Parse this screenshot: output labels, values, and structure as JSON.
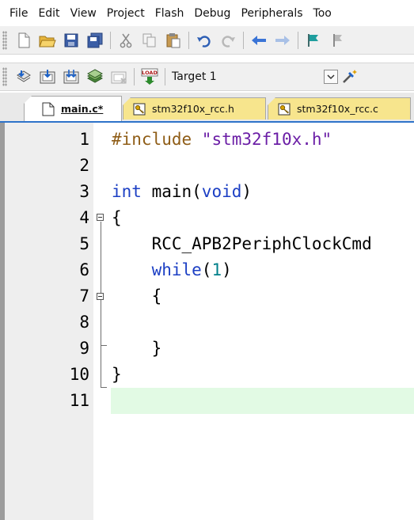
{
  "menu": [
    "File",
    "Edit",
    "View",
    "Project",
    "Flash",
    "Debug",
    "Peripherals",
    "Too"
  ],
  "toolbar1": {
    "icons": [
      "new-file-icon",
      "open-folder-icon",
      "save-icon",
      "save-all-icon",
      "cut-icon",
      "copy-icon",
      "paste-icon",
      "undo-icon",
      "redo-icon",
      "navigate-back-icon",
      "navigate-forward-icon",
      "bookmark-icon",
      "bookmark-prev-icon"
    ]
  },
  "toolbar2": {
    "icons": [
      "translate-icon",
      "build-icon",
      "rebuild-icon",
      "batch-build-icon",
      "stop-build-icon",
      "download-icon",
      "target-options-icon"
    ],
    "download_label": "LOAD",
    "target": "Target 1"
  },
  "tabs": [
    {
      "label": "main.c*",
      "active": true
    },
    {
      "label": "stm32f10x_rcc.h",
      "active": false
    },
    {
      "label": "stm32f10x_rcc.c",
      "active": false
    }
  ],
  "editor": {
    "lines": [
      {
        "n": "1",
        "tokens": [
          {
            "t": "#include ",
            "c": "pp"
          },
          {
            "t": "\"stm32f10x.h\"",
            "c": "str"
          }
        ]
      },
      {
        "n": "2",
        "tokens": []
      },
      {
        "n": "3",
        "tokens": [
          {
            "t": "int",
            "c": "kw"
          },
          {
            "t": " main(",
            "c": ""
          },
          {
            "t": "void",
            "c": "kw"
          },
          {
            "t": ")",
            "c": ""
          }
        ]
      },
      {
        "n": "4",
        "tokens": [
          {
            "t": "{",
            "c": ""
          }
        ]
      },
      {
        "n": "5",
        "tokens": [
          {
            "t": "    RCC_APB2PeriphClockCmd",
            "c": ""
          }
        ]
      },
      {
        "n": "6",
        "tokens": [
          {
            "t": "    ",
            "c": ""
          },
          {
            "t": "while",
            "c": "kw"
          },
          {
            "t": "(",
            "c": ""
          },
          {
            "t": "1",
            "c": "num"
          },
          {
            "t": ")",
            "c": ""
          }
        ]
      },
      {
        "n": "7",
        "tokens": [
          {
            "t": "    {",
            "c": ""
          }
        ]
      },
      {
        "n": "8",
        "tokens": []
      },
      {
        "n": "9",
        "tokens": [
          {
            "t": "    }",
            "c": ""
          }
        ]
      },
      {
        "n": "10",
        "tokens": [
          {
            "t": "}",
            "c": ""
          }
        ]
      },
      {
        "n": "11",
        "tokens": []
      }
    ],
    "current_line": "11"
  },
  "colors": {
    "keyword": "#1c3fc4",
    "preprocessor": "#8f5d17",
    "string": "#6b1ea6",
    "number": "#00808a",
    "current_line_bg": "#e2fae4",
    "tab_active_border": "#2e73c9",
    "tab_inactive_bg": "#f7e58d"
  }
}
